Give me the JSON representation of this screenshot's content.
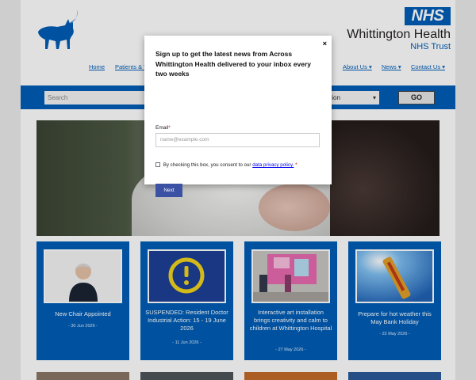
{
  "header": {
    "nhs_badge": "NHS",
    "org_name": "Whittington Health",
    "org_sub": "NHS Trust"
  },
  "nav": {
    "items": [
      "Home",
      "Patients & V",
      "About Us",
      "News",
      "Contact Us"
    ]
  },
  "search": {
    "placeholder": "Search",
    "location_value": "tion",
    "go_label": "GO"
  },
  "news": [
    {
      "title": "New Chair Appointed",
      "date": "- 30 Jun 2026 -"
    },
    {
      "title": "SUSPENDED: Resident Doctor Industrial Action: 15 - 19 June 2026",
      "date": "- 11 Jun 2026 -"
    },
    {
      "title": "Interactive art installation brings creativity and calm to children at Whittington Hospital",
      "date": "- 27 May 2026 -"
    },
    {
      "title": "Prepare for hot weather this May Bank Holiday",
      "date": "- 22 May 2026 -"
    }
  ],
  "modal": {
    "title": "Sign up to get the latest news from Across Whittington Health delivered to your inbox every two weeks",
    "email_label": "Email",
    "required_mark": "*",
    "email_placeholder": "name@example.com",
    "consent_text": "By checking this box, you consent to our",
    "consent_link": "data privacy policy.",
    "next_label": "Next",
    "close_symbol": "×"
  }
}
